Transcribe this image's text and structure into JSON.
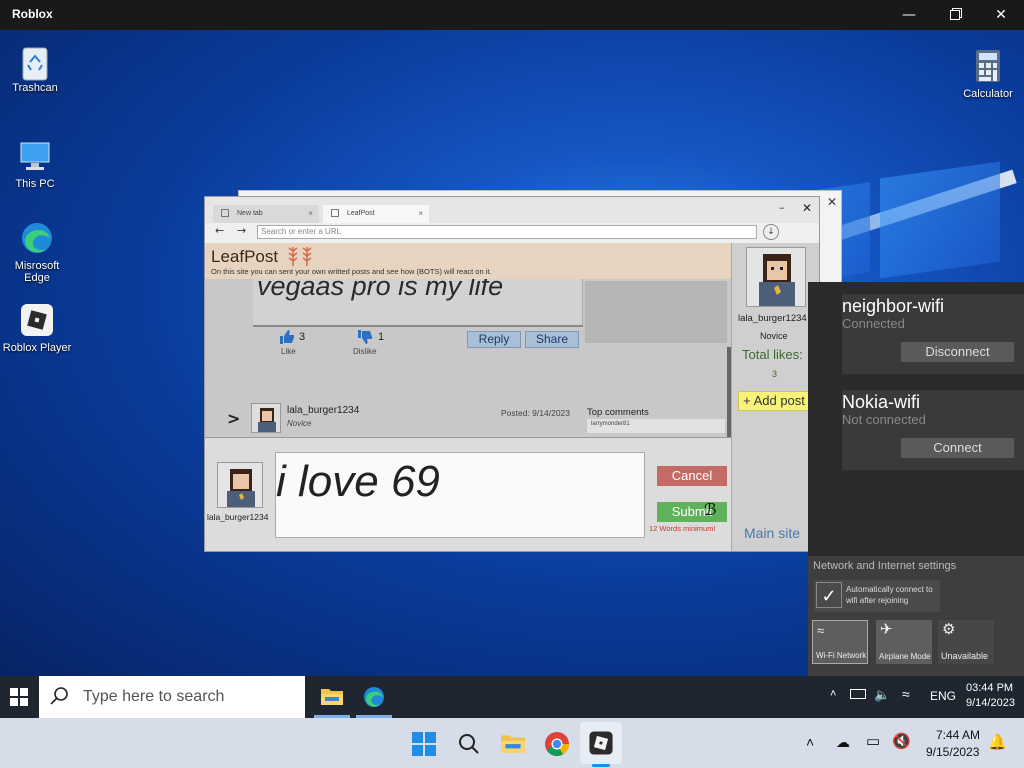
{
  "window": {
    "title": "Roblox"
  },
  "desktop": {
    "icons": [
      "Trashcan",
      "This PC",
      "Misrosoft Edge",
      "Roblox Player",
      "Calculator"
    ]
  },
  "browser": {
    "tabs": [
      {
        "label": "New tab"
      },
      {
        "label": "LeafPost"
      }
    ],
    "url_placeholder": "Search or enter a URL",
    "site": {
      "title": "LeafPost",
      "description": "On this site you can sent your own writted posts and see how (BOTS) will react on it."
    },
    "post": {
      "text": "vegaas pro is my life",
      "like_count": "3",
      "like_label": "Like",
      "dislike_count": "1",
      "dislike_label": "Dislike",
      "reply_label": "Reply",
      "share_label": "Share"
    },
    "next_post": {
      "arrow": ">",
      "username": "lala_burger1234",
      "rank": "Novice",
      "posted": "Posted: 9/14/2023",
      "top_comments_label": "Top comments",
      "first_commenter": "larrymonder81"
    },
    "composer": {
      "username": "lala_burger1234",
      "text": "i love 69",
      "cancel_label": "Cancel",
      "submit_label": "Submit",
      "hint": "12 Words minimum!"
    },
    "profile": {
      "username": "lala_burger1234",
      "rank": "Novice",
      "total_likes_label": "Total likes:",
      "total_likes": "3",
      "add_post_label": "+ Add post",
      "main_site_label": "Main site"
    }
  },
  "wifi": {
    "networks": [
      {
        "name": "neighbor-wifi",
        "status": "Connected",
        "action": "Disconnect"
      },
      {
        "name": "Nokia-wifi",
        "status": "Not connected",
        "action": "Connect"
      }
    ],
    "settings_label": "Network and Internet settings",
    "auto_connect_label": "Automatically connect to wifi after rejoining",
    "tiles": [
      "Wi-Fi Network",
      "Airplane Mode",
      "Unavailable"
    ]
  },
  "taskbar_game": {
    "search_placeholder": "Type here to search",
    "lang": "ENG",
    "time": "03:44 PM",
    "date": "9/14/2023"
  },
  "taskbar_host": {
    "time": "7:44 AM",
    "date": "9/15/2023"
  }
}
